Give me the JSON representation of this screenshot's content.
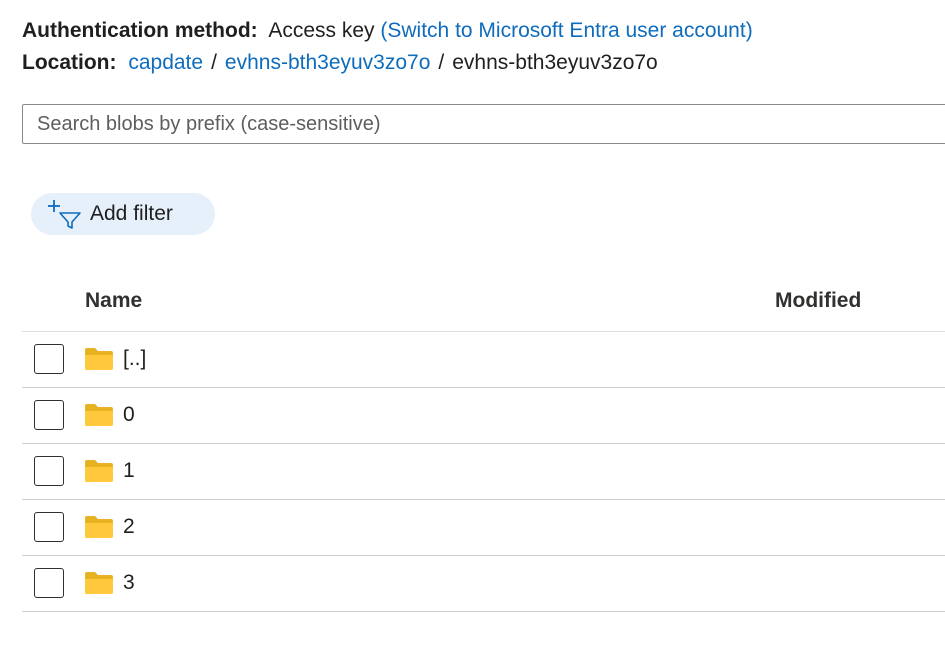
{
  "auth": {
    "label": "Authentication method:",
    "value": "Access key",
    "switch_link": "(Switch to Microsoft Entra user account)"
  },
  "location": {
    "label": "Location:",
    "crumbs": [
      "capdate",
      "evhns-bth3eyuv3zo7o"
    ],
    "separator": "/",
    "current": "evhns-bth3eyuv3zo7o"
  },
  "search": {
    "placeholder": "Search blobs by prefix (case-sensitive)",
    "value": ""
  },
  "filter": {
    "add_label": "Add filter",
    "icon": "add-filter-icon"
  },
  "table": {
    "columns": {
      "name": "Name",
      "modified": "Modified"
    },
    "rows": [
      {
        "name": "[..]",
        "type": "folder",
        "modified": ""
      },
      {
        "name": "0",
        "type": "folder",
        "modified": ""
      },
      {
        "name": "1",
        "type": "folder",
        "modified": ""
      },
      {
        "name": "2",
        "type": "folder",
        "modified": ""
      },
      {
        "name": "3",
        "type": "folder",
        "modified": ""
      }
    ]
  },
  "colors": {
    "link": "#0f6cbd",
    "filter_bg": "#e5f0fb",
    "folder": "#f2c12e"
  }
}
